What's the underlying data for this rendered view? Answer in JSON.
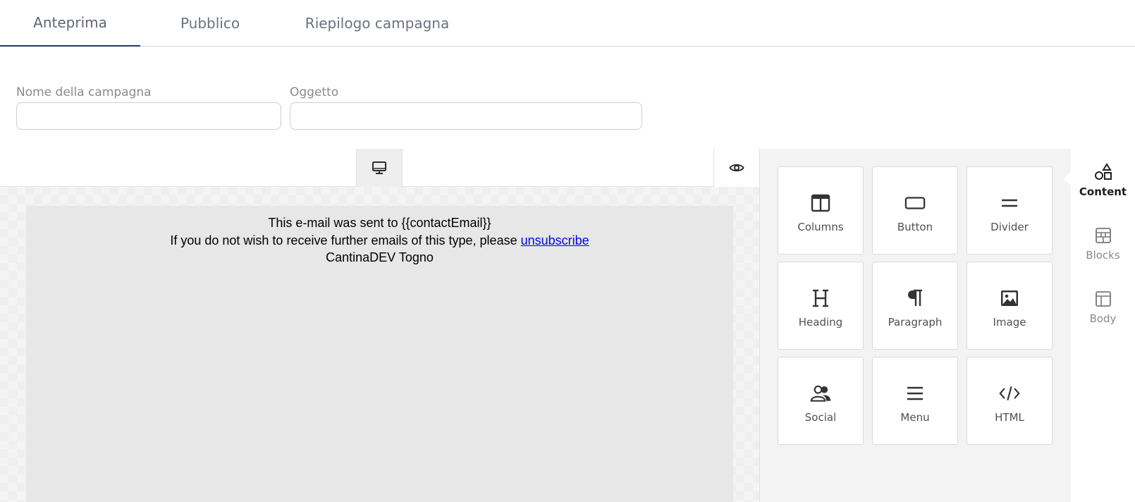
{
  "tabs": [
    {
      "label": "Anteprima",
      "active": true
    },
    {
      "label": "Pubblico",
      "active": false
    },
    {
      "label": "Riepilogo campagna",
      "active": false
    }
  ],
  "form": {
    "campaign_name": {
      "label": "Nome della campagna",
      "value": ""
    },
    "subject": {
      "label": "Oggetto",
      "value": ""
    }
  },
  "toolbar": {
    "device_icon": "desktop-icon",
    "preview_icon": "eye-icon"
  },
  "email": {
    "line1": "This e-mail was sent to {{contactEmail}}",
    "line2_prefix": "If you do not wish to receive further emails of this type, please ",
    "unsubscribe_link": "unsubscribe",
    "line3": "CantinaDEV Togno"
  },
  "content_tools": [
    {
      "label": "Columns",
      "icon": "columns-icon"
    },
    {
      "label": "Button",
      "icon": "button-icon"
    },
    {
      "label": "Divider",
      "icon": "divider-icon"
    },
    {
      "label": "Heading",
      "icon": "heading-icon"
    },
    {
      "label": "Paragraph",
      "icon": "paragraph-icon"
    },
    {
      "label": "Image",
      "icon": "image-icon"
    },
    {
      "label": "Social",
      "icon": "social-icon"
    },
    {
      "label": "Menu",
      "icon": "menu-icon"
    },
    {
      "label": "HTML",
      "icon": "code-icon"
    }
  ],
  "side_nav": [
    {
      "label": "Content",
      "icon": "shapes-icon",
      "active": true
    },
    {
      "label": "Blocks",
      "icon": "blocks-icon",
      "active": false
    },
    {
      "label": "Body",
      "icon": "body-layout-icon",
      "active": false
    }
  ],
  "colors": {
    "active_tab_underline": "#1e3a5f",
    "email_background": "#e7e7e7",
    "link": "#0000ee"
  }
}
